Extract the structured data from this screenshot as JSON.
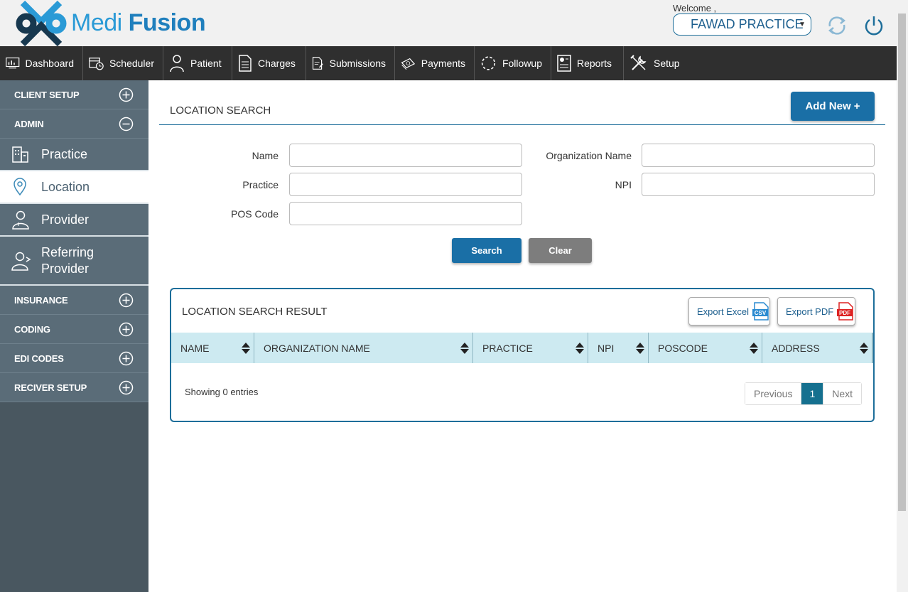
{
  "app": {
    "logo_thin": "Medi",
    "logo_bold": "Fusion",
    "welcome": "Welcome ,",
    "user": "FAWAD PRACTICE"
  },
  "nav": {
    "items": [
      {
        "label": "Dashboard",
        "icon": "dashboard-icon"
      },
      {
        "label": "Scheduler",
        "icon": "calendar-clock-icon"
      },
      {
        "label": "Patient",
        "icon": "person-icon"
      },
      {
        "label": "Charges",
        "icon": "document-icon"
      },
      {
        "label": "Submissions",
        "icon": "document-edit-icon"
      },
      {
        "label": "Payments",
        "icon": "money-icon"
      },
      {
        "label": "Followup",
        "icon": "dashed-circle-icon"
      },
      {
        "label": "Reports",
        "icon": "report-icon"
      },
      {
        "label": "Setup",
        "icon": "tools-icon"
      }
    ]
  },
  "sidebar": {
    "client_setup": "CLIENT SETUP",
    "admin": "ADMIN",
    "practice": "Practice",
    "location": "Location",
    "provider": "Provider",
    "referring_line1": "Referring",
    "referring_line2": "Provider",
    "insurance": "INSURANCE",
    "coding": "CODING",
    "edi_codes": "EDI CODES",
    "receiver_setup": "RECIVER SETUP"
  },
  "page": {
    "title": "LOCATION SEARCH",
    "add_new": "Add New +"
  },
  "form": {
    "name_label": "Name",
    "org_label": "Organization Name",
    "practice_label": "Practice",
    "npi_label": "NPI",
    "pos_label": "POS Code",
    "name_value": "",
    "org_value": "",
    "practice_value": "",
    "npi_value": "",
    "pos_value": "",
    "search": "Search",
    "clear": "Clear"
  },
  "results": {
    "title": "LOCATION SEARCH RESULT",
    "export_excel": "Export Excel",
    "export_pdf": "Export PDF",
    "columns": [
      "NAME",
      "ORGANIZATION NAME",
      "PRACTICE",
      "NPI",
      "POSCODE",
      "ADDRESS"
    ],
    "rows": [],
    "showing": "Showing 0 entries",
    "pager": {
      "previous": "Previous",
      "current": "1",
      "next": "Next"
    }
  },
  "colors": {
    "brand_blue": "#1a6fa6",
    "nav_bg": "#2f2f2f",
    "sidebar_bg": "#5a6c78",
    "table_header": "#cdeaf1"
  }
}
